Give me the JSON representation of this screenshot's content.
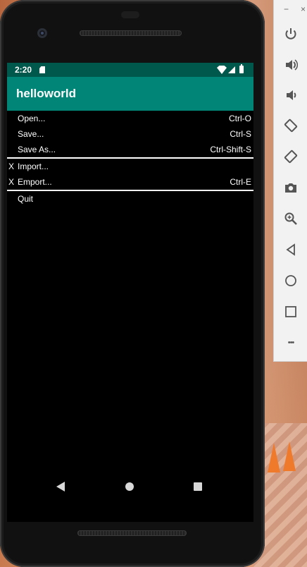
{
  "status_bar": {
    "time": "2:20"
  },
  "app": {
    "title": "helloworld"
  },
  "menu": {
    "items": [
      {
        "check": "",
        "label": "Open...",
        "shortcut": "Ctrl-O"
      },
      {
        "check": "",
        "label": "Save...",
        "shortcut": "Ctrl-S"
      },
      {
        "check": "",
        "label": "Save As...",
        "shortcut": "Ctrl-Shift-S"
      },
      {
        "check": "X",
        "label": "Import...",
        "shortcut": ""
      },
      {
        "check": "X",
        "label": "Emport...",
        "shortcut": "Ctrl-E"
      },
      {
        "check": "",
        "label": "Quit",
        "shortcut": ""
      }
    ]
  },
  "emulator_toolbar": {
    "minimize": "−",
    "close": "×",
    "more": "•••",
    "buttons": [
      "power-icon",
      "volume-up-icon",
      "volume-down-icon",
      "rotate-left-icon",
      "rotate-right-icon",
      "camera-icon",
      "zoom-icon",
      "back-icon",
      "home-icon",
      "overview-icon",
      "more-icon"
    ]
  }
}
